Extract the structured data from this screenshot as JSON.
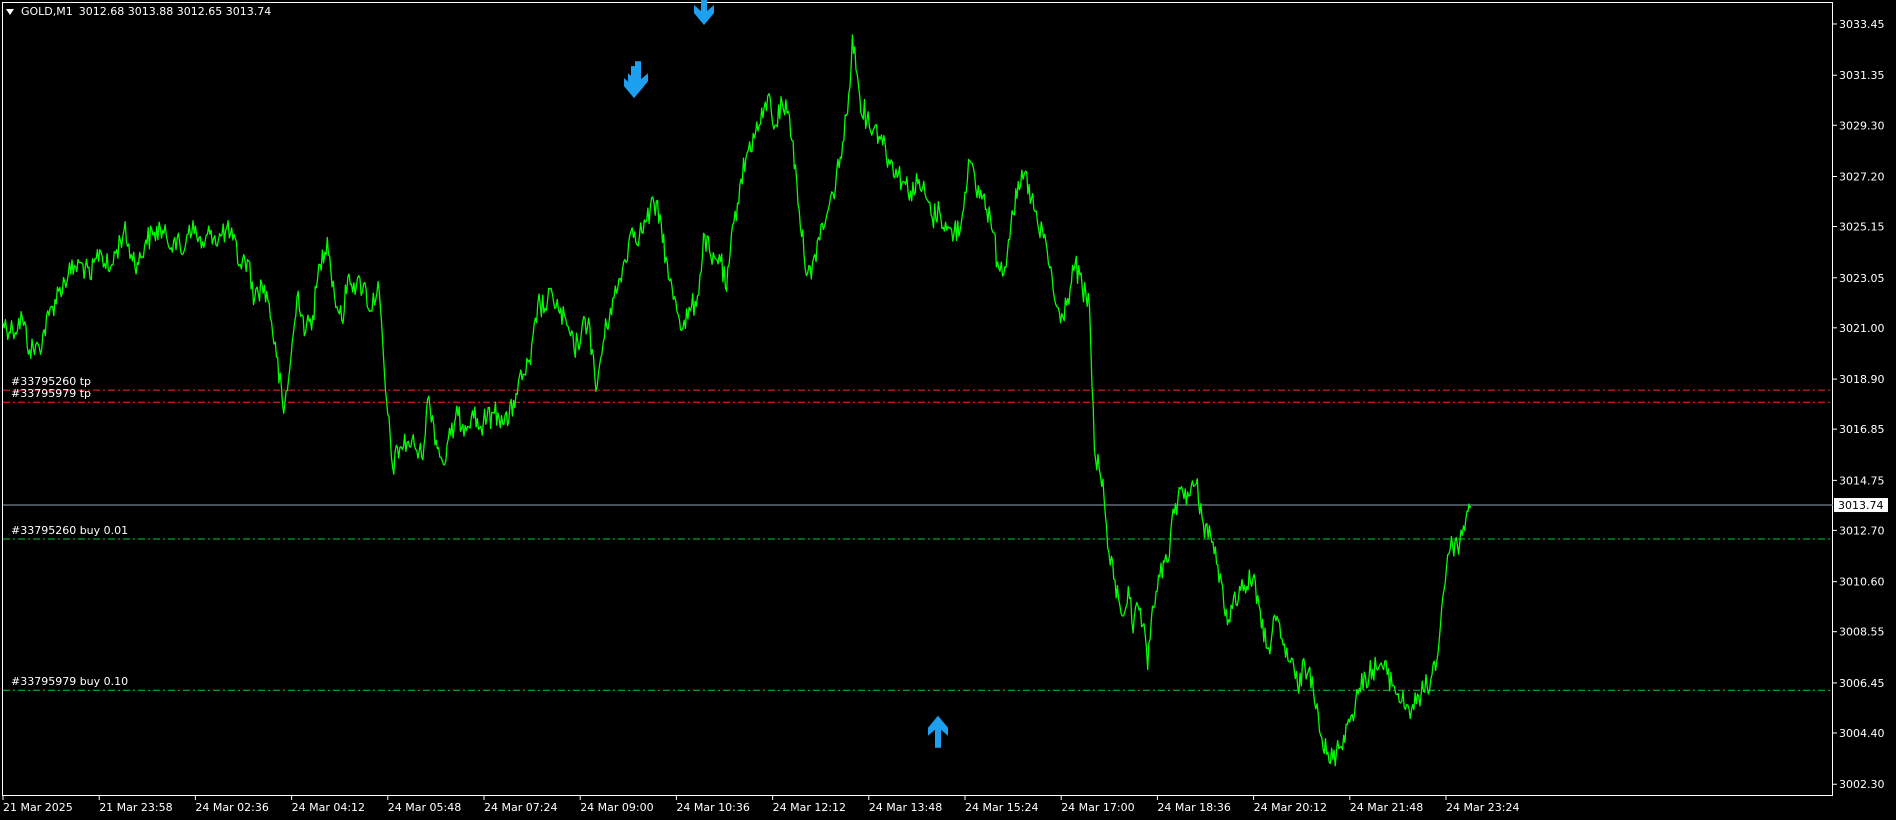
{
  "header": {
    "symbol": "GOLD,M1",
    "ohlc": "3012.68 3013.88 3012.65 3013.74"
  },
  "colors": {
    "background": "#000000",
    "price_line": "#00ff00",
    "axis": "#ffffff",
    "tp_line": "#ff2222",
    "buy_line": "#00cc33",
    "bid_line": "#8fa0b0",
    "arrow": "#1ea0f0"
  },
  "orders": {
    "tp1_label": "#33795260 tp",
    "tp2_label": "#33795979 tp",
    "buy1_label": "#33795260 buy 0.01",
    "buy2_label": "#33795979 buy 0.10"
  },
  "chart_data": {
    "type": "line",
    "y_axis_position": "right",
    "y_ticks": [
      "3033.45",
      "3031.35",
      "3029.30",
      "3027.20",
      "3025.15",
      "3023.05",
      "3021.00",
      "3018.90",
      "3016.85",
      "3014.75",
      "3012.70",
      "3010.60",
      "3008.55",
      "3006.45",
      "3004.40",
      "3002.30"
    ],
    "x_ticks": [
      "21 Mar 2025",
      "21 Mar 23:58",
      "24 Mar 02:36",
      "24 Mar 04:12",
      "24 Mar 05:48",
      "24 Mar 07:24",
      "24 Mar 09:00",
      "24 Mar 10:36",
      "24 Mar 12:12",
      "24 Mar 13:48",
      "24 Mar 15:24",
      "24 Mar 17:00",
      "24 Mar 18:36",
      "24 Mar 20:12",
      "24 Mar 21:48",
      "24 Mar 23:24"
    ],
    "ylim": [
      3001.9,
      3034.35
    ],
    "current_price": "3013.74",
    "levels": {
      "tp_1": 3018.45,
      "tp_2": 3017.95,
      "buy_1": 3012.35,
      "buy_2": 3006.15
    },
    "series": [
      {
        "x": [
          0,
          8,
          16,
          22,
          30,
          38,
          46,
          54,
          60,
          66,
          72,
          80,
          88,
          94,
          100,
          106,
          112,
          118,
          124,
          130,
          136,
          142,
          148,
          154,
          160,
          166,
          172,
          178,
          184,
          190,
          196,
          202,
          208,
          214,
          220,
          226,
          232,
          238,
          244,
          250,
          256,
          262,
          268,
          274,
          280,
          286,
          292,
          298,
          304,
          310,
          316,
          322,
          328,
          334,
          340,
          346,
          352,
          358,
          364,
          370,
          376,
          382,
          388,
          394,
          400,
          406,
          412,
          418,
          424,
          430,
          436,
          442,
          448,
          454,
          460,
          466,
          472,
          478,
          484,
          490,
          496,
          502,
          508,
          514,
          520,
          526,
          532,
          538,
          544,
          550,
          556,
          562,
          568,
          574,
          580,
          586,
          592,
          598,
          604,
          610,
          616,
          622,
          628,
          632,
          638,
          644,
          650,
          656,
          662,
          668,
          674,
          680,
          686,
          692,
          698,
          702,
          708,
          714,
          720,
          726,
          732,
          738,
          744,
          750,
          756,
          762,
          768,
          774,
          780,
          786,
          792,
          798,
          804,
          810,
          816,
          822,
          828,
          834,
          838,
          844,
          850,
          856,
          862,
          868,
          874,
          880,
          886,
          892,
          898,
          902,
          906,
          910,
          914,
          918,
          922,
          926,
          930,
          934,
          938,
          942,
          946,
          950,
          956,
          962,
          968,
          974,
          980,
          986,
          992,
          998,
          1004,
          1010,
          1016,
          1022,
          1028,
          1034,
          1040,
          1046,
          1052,
          1058,
          1064,
          1070,
          1076,
          1082,
          1086,
          1090,
          1096,
          1102,
          1108,
          1114,
          1120,
          1126,
          1132,
          1138,
          1144,
          1150,
          1156,
          1162,
          1168,
          1174,
          1180,
          1186,
          1190,
          1194,
          1198,
          1202,
          1206,
          1210,
          1213
        ],
        "values": [
          3021.2,
          3020.9,
          3021.4,
          3020.1,
          3020.2,
          3021.5,
          3022.5,
          3023.2,
          3023.5,
          3023.6,
          3023.0,
          3024.2,
          3023.3,
          3024.2,
          3025.0,
          3024.0,
          3023.6,
          3024.6,
          3024.8,
          3025.1,
          3024.5,
          3024.7,
          3024.0,
          3025.2,
          3024.8,
          3024.3,
          3025.0,
          3024.6,
          3025.0,
          3024.6,
          3023.6,
          3023.8,
          3022.2,
          3022.8,
          3022.0,
          3019.8,
          3017.5,
          3019.8,
          3022.5,
          3020.8,
          3021.5,
          3023.6,
          3024.7,
          3022.3,
          3021.3,
          3023.2,
          3022.7,
          3022.8,
          3021.7,
          3022.9,
          3018.5,
          3015.3,
          3016.1,
          3016.3,
          3016.2,
          3015.7,
          3018.2,
          3016.4,
          3015.4,
          3016.6,
          3017.4,
          3017.0,
          3017.6,
          3016.9,
          3017.3,
          3017.5,
          3017.4,
          3017.2,
          3018.3,
          3019.1,
          3019.5,
          3022.0,
          3021.8,
          3022.4,
          3021.6,
          3021.1,
          3020.1,
          3020.8,
          3021.4,
          3018.4,
          3020.4,
          3021.8,
          3022.6,
          3023.8,
          3025.1,
          3024.8,
          3025.4,
          3026.1,
          3025.3,
          3023.0,
          3022.1,
          3021.0,
          3021.7,
          3022.3,
          3024.8,
          3023.6,
          3024.0,
          3022.5,
          3025.3,
          3027.1,
          3028.3,
          3029.0,
          3029.6,
          3030.5,
          3029.3,
          3030.2,
          3029.7,
          3027.0,
          3024.0,
          3023.0,
          3024.7,
          3025.4,
          3026.5,
          3028.0,
          3029.8,
          3033.0,
          3030.5,
          3029.5,
          3029.2,
          3028.9,
          3027.9,
          3027.5,
          3027.0,
          3026.6,
          3026.9,
          3026.5,
          3025.5,
          3025.8,
          3025.0,
          3024.9,
          3025.3,
          3027.9,
          3026.7,
          3026.4,
          3025.5,
          3023.7,
          3023.5,
          3025.8,
          3026.3,
          3027.3,
          3026.3,
          3025.0,
          3024.5,
          3022.5,
          3021.2,
          3022.2,
          3023.6,
          3022.6,
          3021.8,
          3016.0,
          3015.2,
          3014.0,
          3011.8,
          3010.7,
          3009.9,
          3009.2,
          3010.4,
          3008.5,
          3009.6,
          3008.8,
          3007.0,
          3009.6,
          3010.8,
          3011.4,
          3013.4,
          3014.5,
          3014.1,
          3014.6,
          3013.0,
          3012.5,
          3011.3,
          3009.2,
          3009.5,
          3010.4,
          3010.4,
          3010.9,
          3008.7,
          3007.9,
          3009.0,
          3008.0,
          3007.3,
          3006.3,
          3007.1,
          3006.7,
          3005.6,
          3004.2,
          3003.2,
          3003.6,
          3004.3,
          3005.1,
          3006.0,
          3006.7,
          3007.0,
          3007.2,
          3006.8,
          3006.3,
          3005.7,
          3005.4,
          3005.6,
          3006.1,
          3006.6,
          3007.7,
          3010.0,
          3011.7,
          3012.1,
          3012.1,
          3012.5,
          3013.5,
          3013.7
        ]
      }
    ],
    "markers": [
      {
        "type": "sell-arrow",
        "x": 704,
        "price": 3033.0
      },
      {
        "type": "sell-arrow",
        "x": 638,
        "price": 3030.2
      },
      {
        "type": "sell-arrow",
        "x": 634,
        "price": 3030.0
      },
      {
        "type": "buy-arrow",
        "x": 938,
        "price": 3005.6
      }
    ]
  }
}
